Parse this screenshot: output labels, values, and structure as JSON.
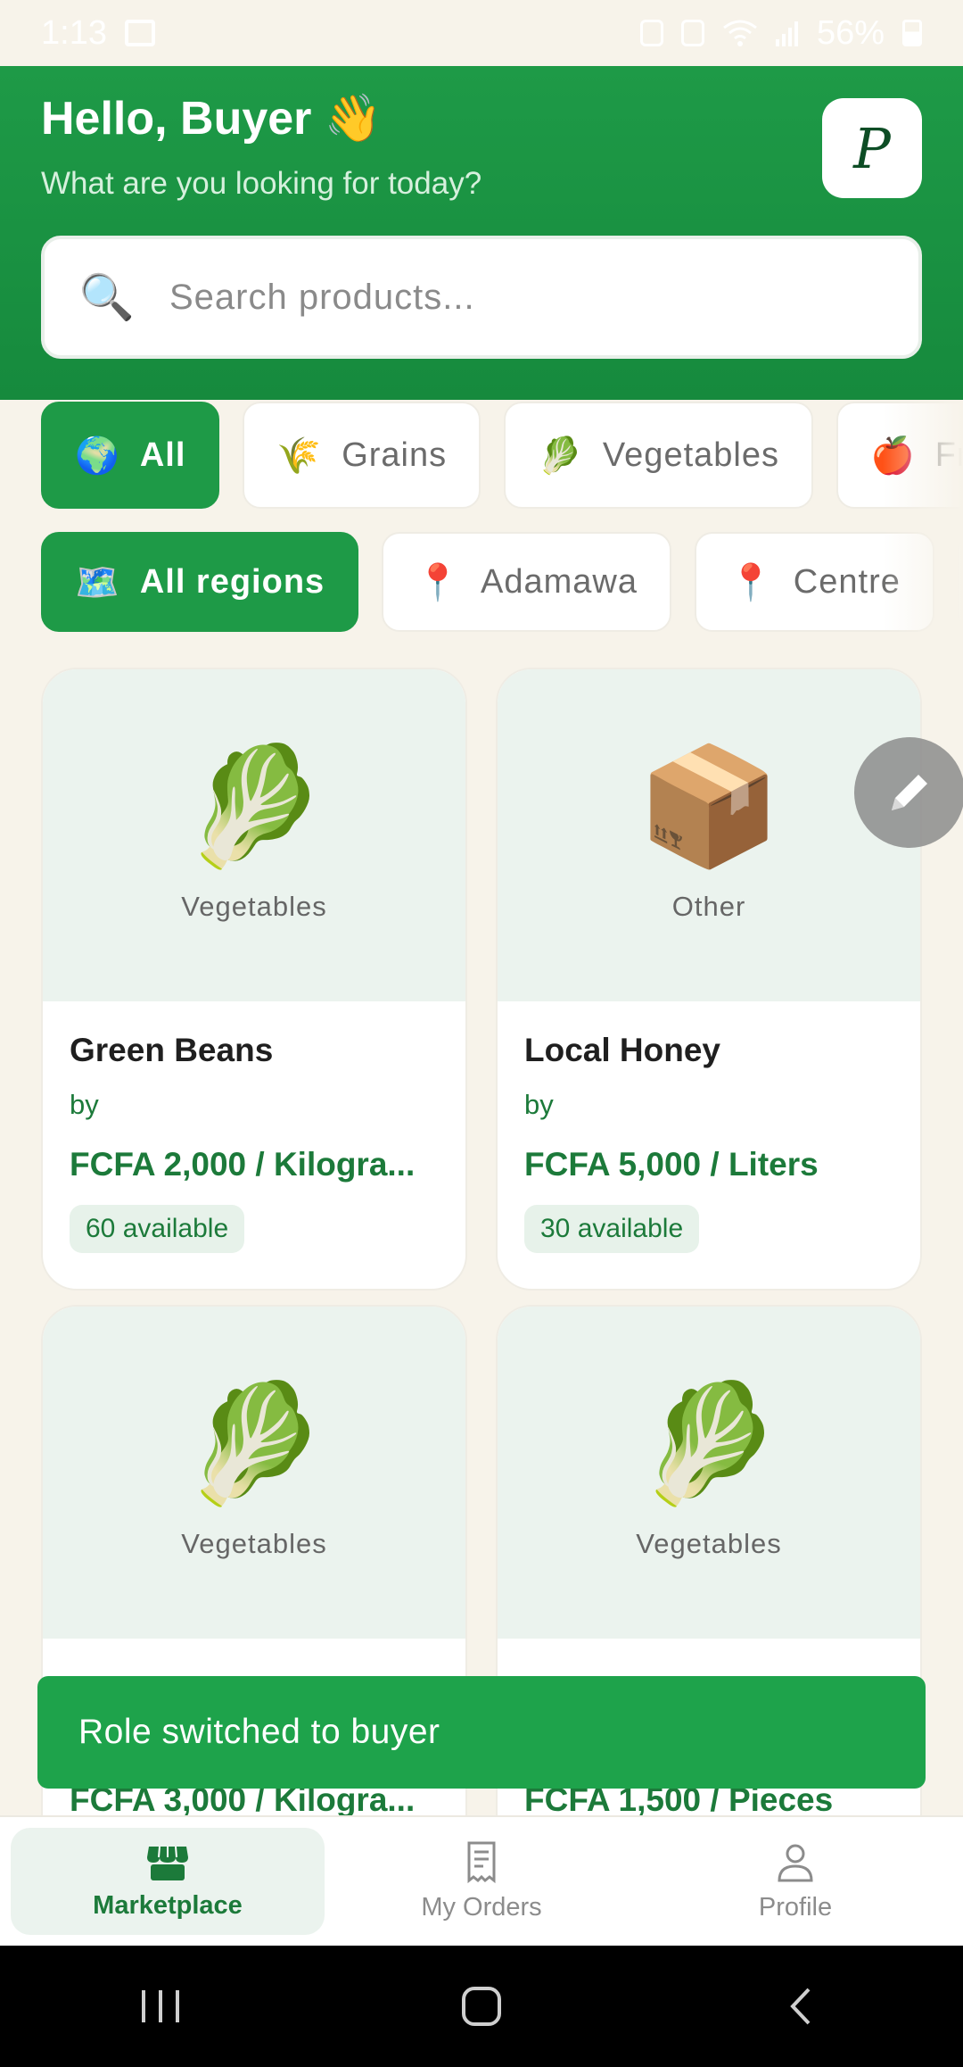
{
  "status_bar": {
    "time": "1:13",
    "battery": "56%"
  },
  "header": {
    "greeting": "Hello, Buyer 👋",
    "subtitle": "What are you looking for today?",
    "logo_letter": "P"
  },
  "search": {
    "placeholder": "Search products...",
    "icon": "🔍"
  },
  "categories": [
    {
      "emoji": "🌍",
      "label": "All",
      "active": true
    },
    {
      "emoji": "🌾",
      "label": "Grains",
      "active": false
    },
    {
      "emoji": "🥬",
      "label": "Vegetables",
      "active": false
    },
    {
      "emoji": "🍎",
      "label": "Fruits",
      "active": false
    }
  ],
  "regions": [
    {
      "emoji": "🗺️",
      "label": "All regions",
      "active": true
    },
    {
      "emoji": "📍",
      "label": "Adamawa",
      "active": false
    },
    {
      "emoji": "📍",
      "label": "Centre",
      "active": false
    },
    {
      "emoji": "📍",
      "label": "",
      "active": false
    }
  ],
  "products": [
    {
      "emoji": "🥬",
      "category": "Vegetables",
      "name": "Green Beans",
      "by": "by",
      "price": "FCFA 2,000 / Kilogra...",
      "available": "60 available"
    },
    {
      "emoji": "📦",
      "category": "Other",
      "name": "Local Honey",
      "by": "by",
      "price": "FCFA 5,000 / Liters",
      "available": "30 available"
    },
    {
      "emoji": "🥬",
      "category": "Vegetables",
      "name": "",
      "by": "",
      "price": "FCFA 3,000 / Kilogra...",
      "available": ""
    },
    {
      "emoji": "🥬",
      "category": "Vegetables",
      "name": "",
      "by": "",
      "price": "FCFA 1,500 / Pieces",
      "available": ""
    }
  ],
  "toast": {
    "message": "Role switched to buyer"
  },
  "bottom_nav": [
    {
      "label": "Marketplace",
      "icon": "store-icon",
      "active": true
    },
    {
      "label": "My Orders",
      "icon": "receipt-icon",
      "active": false
    },
    {
      "label": "Profile",
      "icon": "person-icon",
      "active": false
    }
  ],
  "colors": {
    "primary": "#1e9a47",
    "primary_dark": "#168a3d",
    "background": "#f7f3ea",
    "price": "#1c7a3a"
  }
}
